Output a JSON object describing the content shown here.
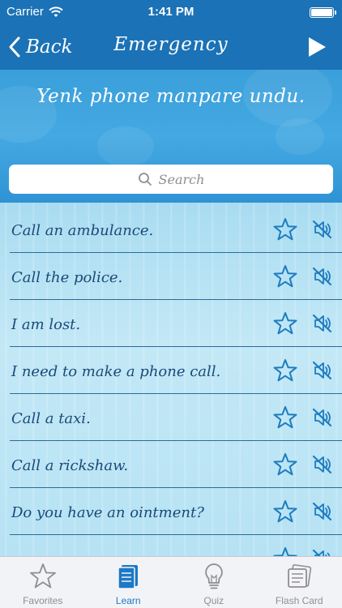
{
  "status_bar": {
    "carrier": "Carrier",
    "time": "1:41 PM"
  },
  "nav": {
    "back_label": "Back",
    "title": "Emergency"
  },
  "banner": {
    "phrase": "Yenk phone manpare undu."
  },
  "search": {
    "placeholder": "Search"
  },
  "phrases": [
    {
      "text": "Call an ambulance."
    },
    {
      "text": "Call the police."
    },
    {
      "text": "I am lost."
    },
    {
      "text": "I need to make a phone call."
    },
    {
      "text": "Call a taxi."
    },
    {
      "text": "Call a rickshaw."
    },
    {
      "text": "Do you have an ointment?"
    },
    {
      "text": ""
    }
  ],
  "tabs": [
    {
      "label": "Favorites",
      "icon": "star-icon",
      "active": false
    },
    {
      "label": "Learn",
      "icon": "book-icon",
      "active": true
    },
    {
      "label": "Quiz",
      "icon": "lightbulb-icon",
      "active": false
    },
    {
      "label": "Flash Card",
      "icon": "flash-card-icon",
      "active": false
    }
  ],
  "colors": {
    "bar": "#1b72b6",
    "banner": "#3a9fda",
    "list_text": "#1a4a78",
    "icon": "#1d7cc0",
    "active_tab": "#1c79c6"
  }
}
